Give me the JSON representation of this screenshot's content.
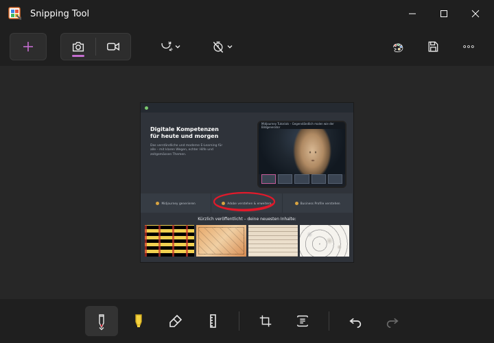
{
  "app": {
    "title": "Snipping Tool"
  },
  "toolbar": {
    "new_label": "New",
    "snapshot_label": "Snapshot",
    "record_label": "Record",
    "shape_label": "Shape",
    "delay_label": "Delay"
  },
  "screenshot": {
    "headline_line1": "Digitale Kompetenzen",
    "headline_line2": "für heute und morgen",
    "subtext": "Das verständliche und moderne E-Learning für alle – mit klaren Wegen, echter Hilfe und zeitgemässen Themen.",
    "tablet_caption": "Midjourney Tutorials – Gegenständlich malen wie der Bildgenerator",
    "band_item1": "Midjourney generieren",
    "band_item2": "Adobe verstehen & erweitern",
    "band_item3": "Business Profile verstehen",
    "section_title": "Kürzlich veröffentlicht – deine neuesten Inhalte:"
  },
  "bottom": {
    "pen": "Pen",
    "highlighter": "Highlighter",
    "eraser": "Eraser",
    "ruler": "Ruler",
    "crop": "Crop",
    "text_actions": "Text actions",
    "undo": "Undo",
    "redo": "Redo"
  },
  "colors": {
    "accent": "#c56dd0",
    "pen": "#e11a2b",
    "highlight": "#f5d33f"
  }
}
